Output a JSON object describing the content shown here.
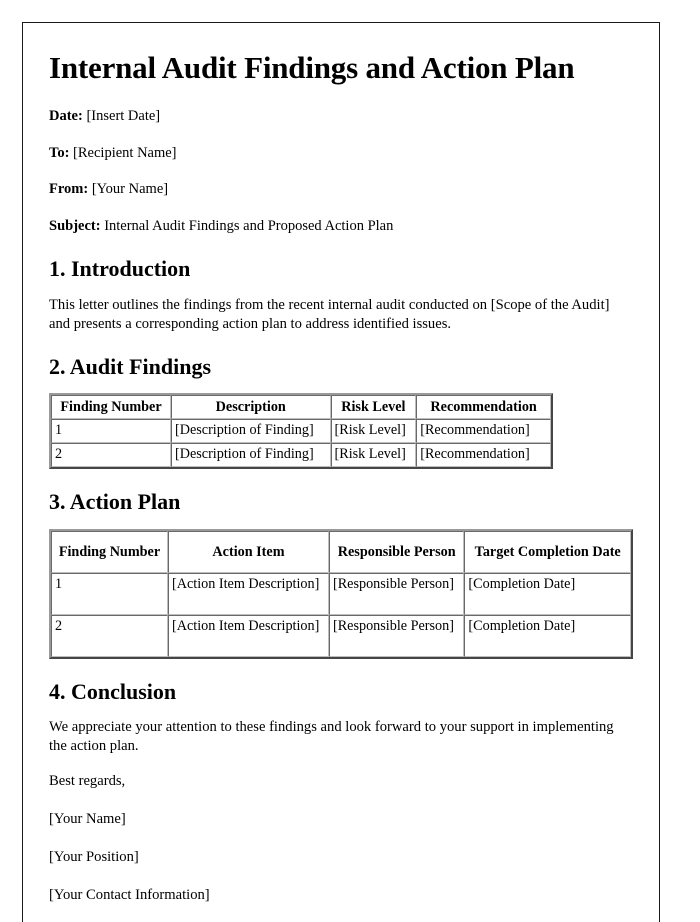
{
  "document": {
    "title": "Internal Audit Findings and Action Plan",
    "meta": [
      {
        "label": "Date:",
        "value": "[Insert Date]"
      },
      {
        "label": "To:",
        "value": "[Recipient Name]"
      },
      {
        "label": "From:",
        "value": "[Your Name]"
      },
      {
        "label": "Subject:",
        "value": "Internal Audit Findings and Proposed Action Plan"
      }
    ],
    "sections": {
      "introduction": {
        "heading": "1. Introduction",
        "paragraph": "This letter outlines the findings from the recent internal audit conducted on [Scope of the Audit] and presents a corresponding action plan to address identified issues."
      },
      "audit_findings": {
        "heading": "2. Audit Findings",
        "table": {
          "headers": [
            "Finding Number",
            "Description",
            "Risk Level",
            "Recommendation"
          ],
          "rows": [
            [
              "1",
              "[Description of Finding]",
              "[Risk Level]",
              "[Recommendation]"
            ],
            [
              "2",
              "[Description of Finding]",
              "[Risk Level]",
              "[Recommendation]"
            ]
          ]
        }
      },
      "action_plan": {
        "heading": "3. Action Plan",
        "table": {
          "headers": [
            "Finding Number",
            "Action Item",
            "Responsible Person",
            "Target Completion Date"
          ],
          "rows": [
            [
              "1",
              "[Action Item Description]",
              "[Responsible Person]",
              "[Completion Date]"
            ],
            [
              "2",
              "[Action Item Description]",
              "[Responsible Person]",
              "[Completion Date]"
            ]
          ]
        }
      },
      "conclusion": {
        "heading": "4. Conclusion",
        "paragraph": "We appreciate your attention to these findings and look forward to your support in implementing the action plan.",
        "closing": "Best regards,",
        "signature": [
          "[Your Name]",
          "[Your Position]",
          "[Your Contact Information]"
        ]
      }
    }
  }
}
